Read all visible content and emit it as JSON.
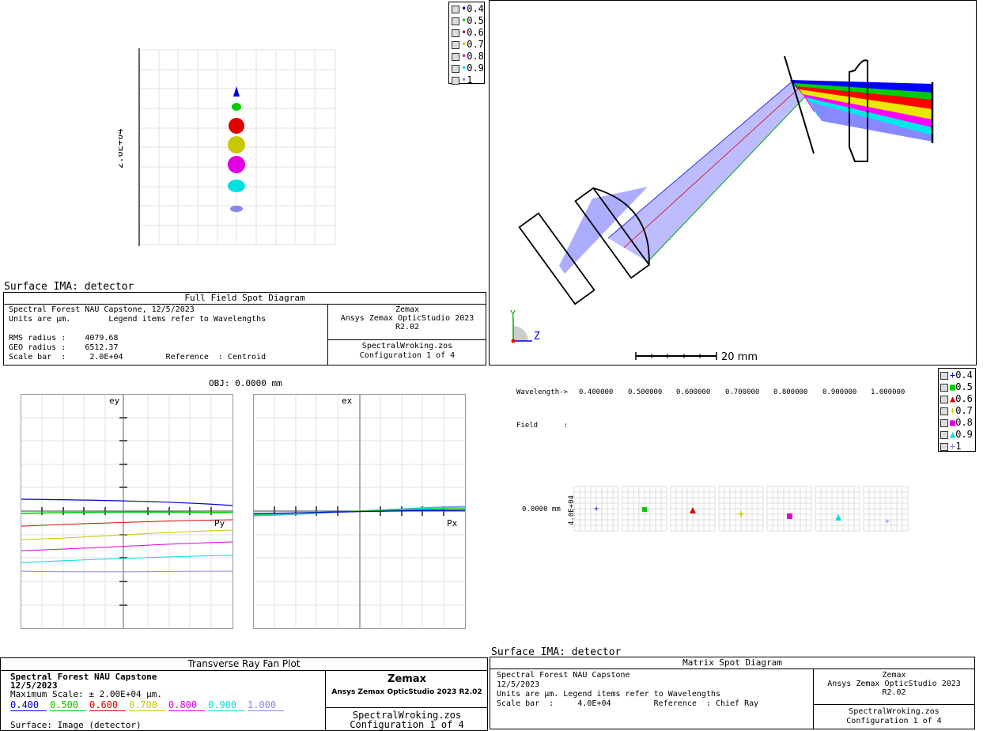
{
  "spot": {
    "scale_label": "2.0E+04",
    "surface": "Surface IMA: detector",
    "title": "Full Field Spot Diagram",
    "info_line1": "Spectral Forest NAU Capstone, 12/5/2023",
    "info_line2": "Units are µm.        Legend items refer to Wavelengths",
    "rms": "RMS radius :    4079.68",
    "geo": "GEO radius :    6512.37",
    "scalebar": "Scale bar  :     2.0E+04         Reference  : Centroid",
    "brand": "Zemax",
    "product": "Ansys Zemax OpticStudio 2023 R2.02",
    "file": "SpectralWroking.zos",
    "config": "Configuration 1 of 4"
  },
  "legend_top": [
    "0.4",
    "0.5",
    "0.6",
    "0.7",
    "0.8",
    "0.9",
    "1"
  ],
  "legend_right": [
    "0.4",
    "0.5",
    "0.6",
    "0.7",
    "0.8",
    "0.9",
    "1"
  ],
  "wave_colors": [
    "#0000d8",
    "#00cc00",
    "#e00000",
    "#c8c800",
    "#e000e0",
    "#00e0e0",
    "#8888e8"
  ],
  "layout": {
    "axis_y": "Y",
    "axis_z": "Z",
    "scale": "20 mm"
  },
  "fan": {
    "obj": "OBJ: 0.0000 mm",
    "ey": "ey",
    "ex": "ex",
    "py": "Py",
    "px": "Px",
    "title": "Transverse Ray Fan Plot",
    "info1": "Spectral Forest NAU Capstone",
    "info2": "12/5/2023",
    "info3": "Maximum Scale: ± 2.00E+04 µm.",
    "waves": [
      "0.400",
      "0.500",
      "0.600",
      "0.700",
      "0.800",
      "0.900",
      "1.000"
    ],
    "surface": "Surface: Image (detector)",
    "brand": "Zemax",
    "product": "Ansys Zemax OpticStudio 2023 R2.02",
    "file": "SpectralWroking.zos",
    "config": "Configuration 1 of 4"
  },
  "matrix": {
    "wl_label": "Wavelength->",
    "wavelengths": [
      "0.400000",
      "0.500000",
      "0.600000",
      "0.700000",
      "0.800000",
      "0.900000",
      "1.000000"
    ],
    "field_label": "Field      :",
    "field_value": "0.0000 mm",
    "scale_side": "4.0E+04",
    "surface": "Surface IMA: detector",
    "title": "Matrix Spot Diagram",
    "info1": "Spectral Forest NAU Capstone",
    "info2": "12/5/2023",
    "info3": "Units are µm. Legend items refer to Wavelengths",
    "info4": "Scale bar  :     4.0E+04         Reference  : Chief Ray",
    "brand": "Zemax",
    "product": "Ansys Zemax OpticStudio 2023 R2.02",
    "file": "SpectralWroking.zos",
    "config": "Configuration 1 of 4"
  }
}
